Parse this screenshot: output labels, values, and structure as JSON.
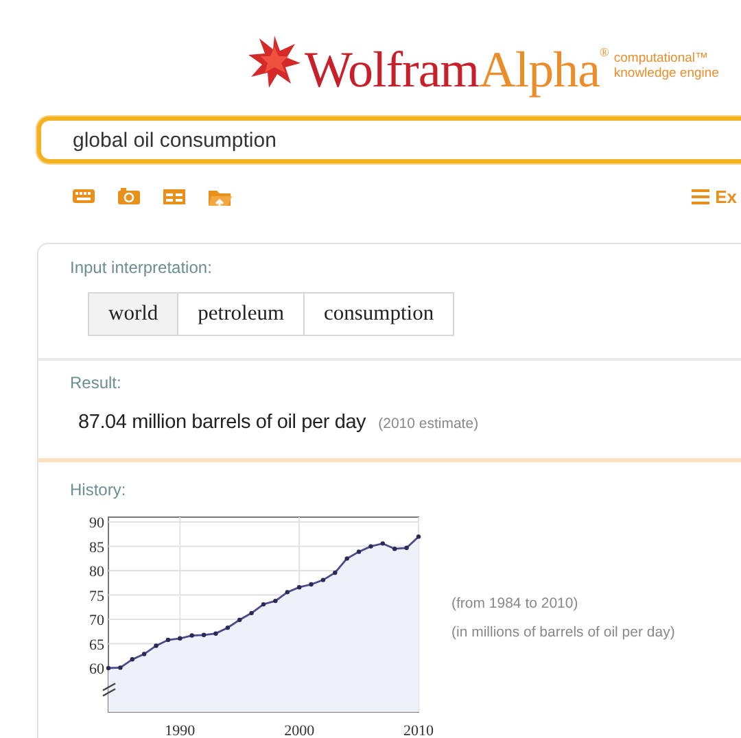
{
  "logo": {
    "word_first": "Wolfram",
    "word_second": "Alpha",
    "mark": "®",
    "tagline": [
      "computational™",
      "knowledge engine"
    ]
  },
  "search": {
    "value": "global oil consumption"
  },
  "toolbar": {
    "menu_label": "Ex"
  },
  "pods": [
    {
      "kind": "interpretation",
      "title": "Input interpretation:",
      "chips": [
        {
          "label": "world",
          "shaded": true
        },
        {
          "label": "petroleum",
          "shaded": false
        },
        {
          "label": "consumption",
          "shaded": false
        }
      ]
    },
    {
      "kind": "result",
      "title": "Result:",
      "value": "87.04 million barrels of oil per day",
      "note": "(2010 estimate)"
    },
    {
      "kind": "chart",
      "title": "History:",
      "notes": [
        "(from 1984 to 2010)",
        "(in millions of barrels of oil per day)"
      ],
      "chart_data": {
        "type": "area",
        "grid": true,
        "xlim": [
          1984,
          2010
        ],
        "ylim": [
          51,
          91
        ],
        "xticks": [
          1990,
          2000,
          2010
        ],
        "yticks": [
          60,
          65,
          70,
          75,
          80,
          85,
          90
        ],
        "x": [
          1984,
          1985,
          1986,
          1987,
          1988,
          1989,
          1990,
          1991,
          1992,
          1993,
          1994,
          1995,
          1996,
          1997,
          1998,
          1999,
          2000,
          2001,
          2002,
          2003,
          2004,
          2005,
          2006,
          2007,
          2008,
          2009,
          2010
        ],
        "series": [
          {
            "color": "#4b4a8c",
            "marker": true,
            "values": [
              60.0,
              60.1,
              61.8,
              62.9,
              64.6,
              65.8,
              66.1,
              66.7,
              66.8,
              67.1,
              68.3,
              69.9,
              71.3,
              73.1,
              73.8,
              75.6,
              76.6,
              77.2,
              78.1,
              79.6,
              82.5,
              83.9,
              85.0,
              85.6,
              84.5,
              84.7,
              87.0
            ]
          }
        ]
      }
    }
  ]
}
